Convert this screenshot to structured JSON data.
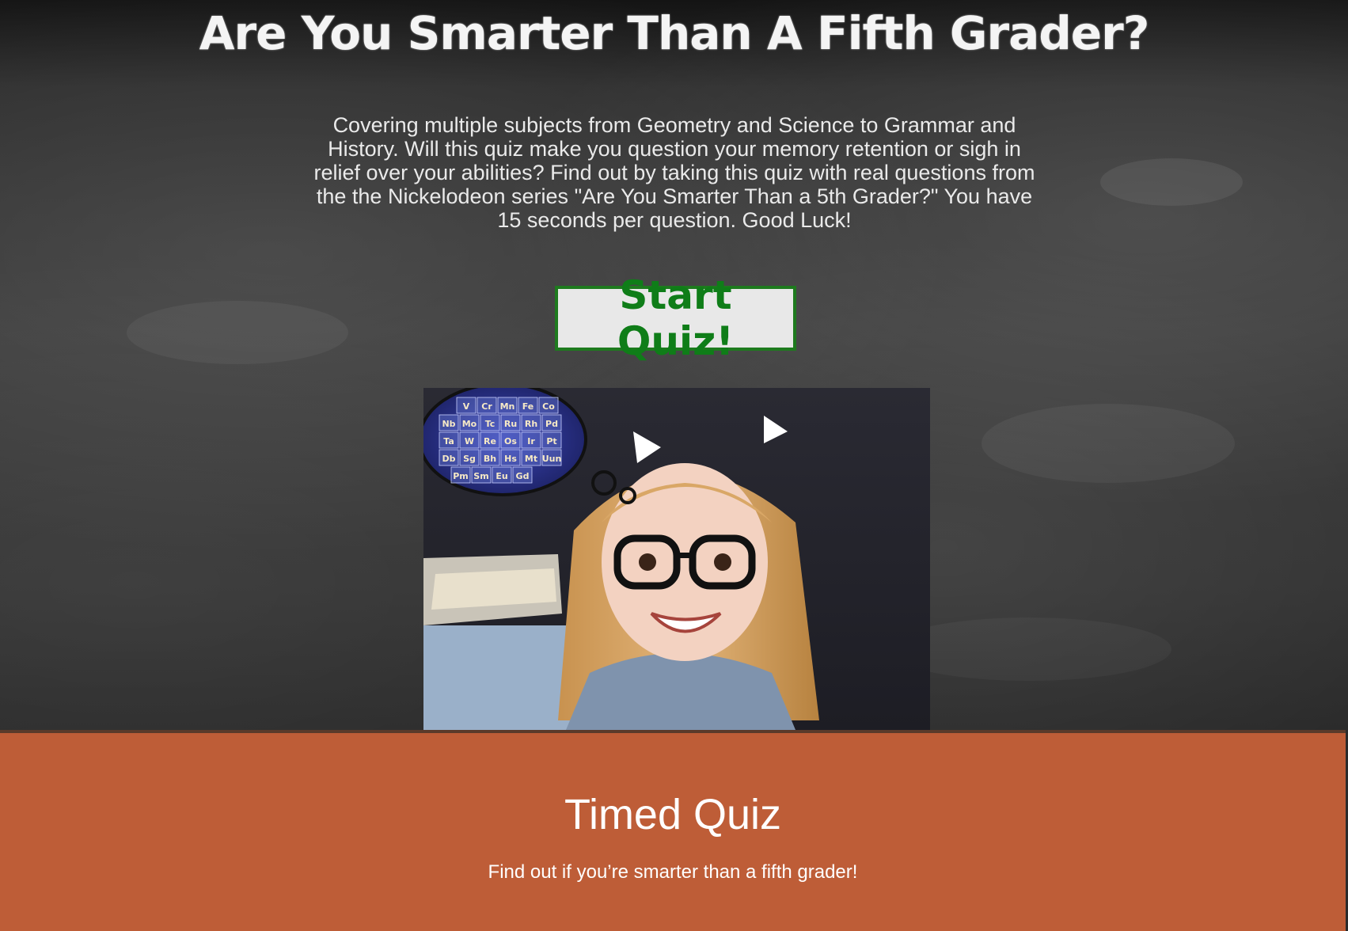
{
  "header": {
    "title": "Are You Smarter Than A Fifth Grader?"
  },
  "intro": {
    "description": "Covering multiple subjects from Geometry and Science to Grammar and History. Will this quiz make you question your memory retention or sigh in relief over your abilities? Find out by taking this quiz with real questions from the the Nickelodeon series \"Are You Smarter Than a 5th Grader?\" You have 15 seconds per question. Good Luck!"
  },
  "actions": {
    "start_label": "Start Quiz!"
  },
  "hero": {
    "periodic_elements": [
      "V",
      "Cr",
      "Mn",
      "Fe",
      "Co",
      "Nb",
      "Mo",
      "Tc",
      "Ru",
      "Rh",
      "Pd",
      "Ta",
      "W",
      "Re",
      "Os",
      "Ir",
      "Pt",
      "Db",
      "Sg",
      "Bh",
      "Hs",
      "Mt",
      "Uun",
      "Pm",
      "Sm",
      "Eu",
      "Gd"
    ]
  },
  "footer": {
    "title": "Timed Quiz",
    "subtitle": "Find out if you’re smarter than a fifth grader!"
  },
  "colors": {
    "chalkboard": "#333333",
    "button_green": "#0f7d18",
    "footer_orange": "#be5d37"
  }
}
